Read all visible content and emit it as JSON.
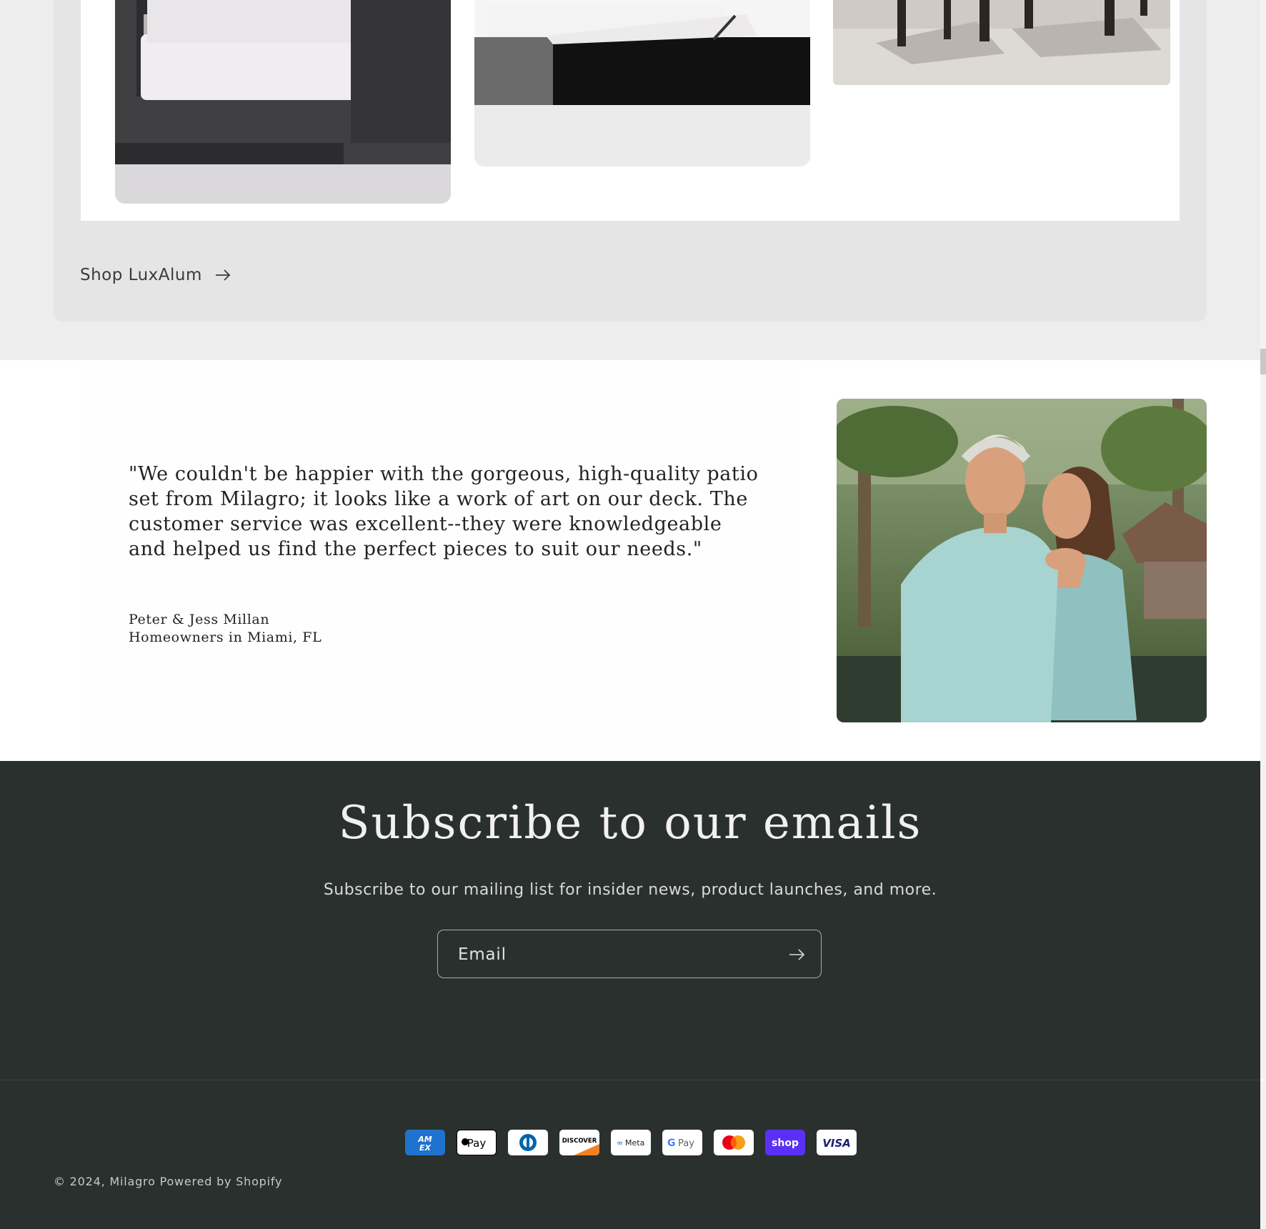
{
  "collection": {
    "shop_link_label": "Shop LuxAlum",
    "products": [
      {
        "icon": "lounge-chair-photo"
      },
      {
        "icon": "chaise-lounge-photo"
      },
      {
        "icon": "dining-set-photo"
      }
    ]
  },
  "testimonial": {
    "quote": "\"We couldn't be happier with the gorgeous, high-quality patio set from Milagro; it looks like a work of art on our deck. The customer service was excellent--they were knowledgeable and helped us find the perfect pieces to suit our needs.\"",
    "author_name": "Peter & Jess Millan",
    "author_title": "Homeowners in Miami, FL",
    "photo_icon": "couple-photo"
  },
  "newsletter": {
    "title": "Subscribe to our emails",
    "text": "Subscribe to our mailing list for insider news, product launches, and more.",
    "email_placeholder": "Email"
  },
  "footer": {
    "payment_methods": [
      "American Express",
      "Apple Pay",
      "Diners Club",
      "Discover",
      "Meta Pay",
      "Google Pay",
      "Mastercard",
      "Shop Pay",
      "Visa"
    ],
    "copyright_prefix": "© 2024,",
    "brand": "Milagro",
    "powered_by": "Powered by Shopify"
  },
  "colors": {
    "footer_bg": "#2a302d",
    "collection_bg": "#e6e5e6",
    "text_dark": "#232323"
  }
}
